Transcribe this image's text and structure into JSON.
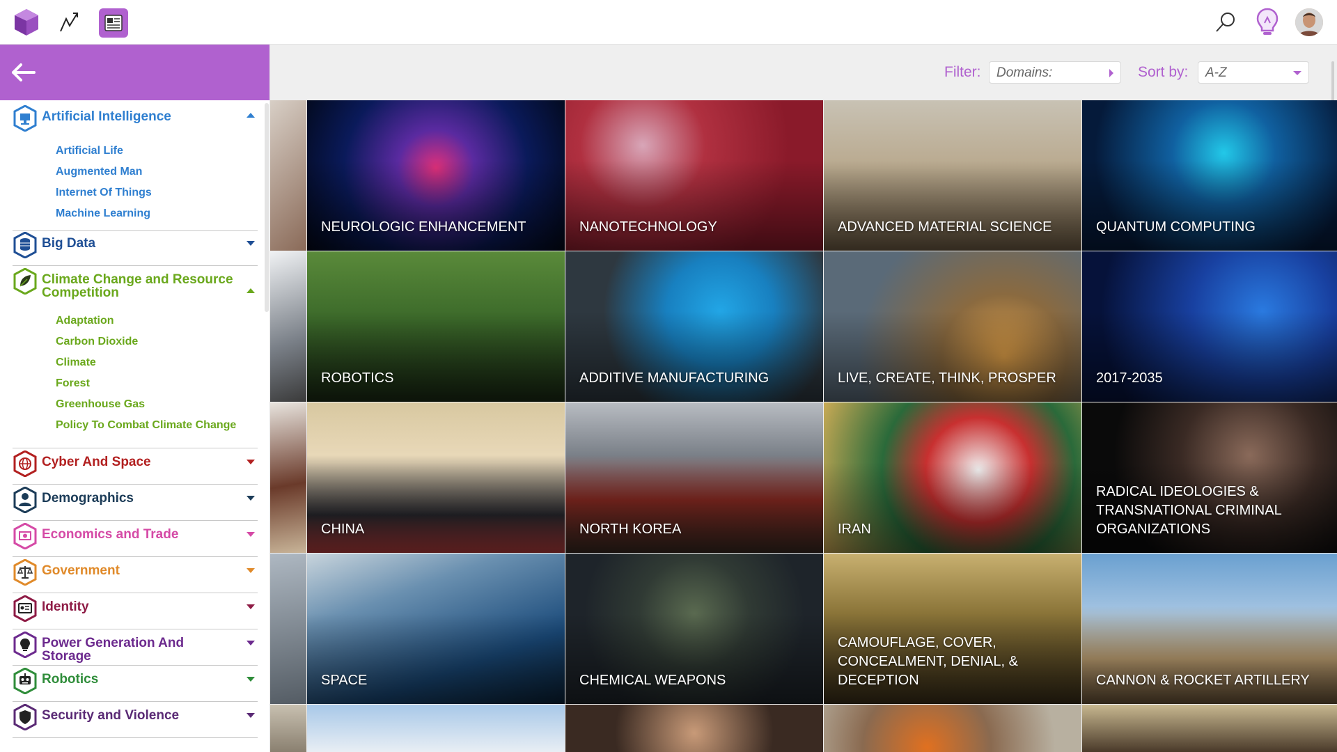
{
  "sidebar": {
    "categories": [
      {
        "title": "Artificial Intelligence",
        "color": "#2f7fd0",
        "expanded": true,
        "icon": "computer-monitor-icon",
        "items": [
          "Artificial Life",
          "Augmented Man",
          "Internet Of Things",
          "Machine Learning"
        ]
      },
      {
        "title": "Big Data",
        "color": "#1f4f95",
        "expanded": false,
        "icon": "database-icon",
        "items": []
      },
      {
        "title": "Climate Change and Resource Competition",
        "color": "#6aa81c",
        "expanded": true,
        "icon": "leaf-icon",
        "items": [
          "Adaptation",
          "Carbon Dioxide",
          "Climate",
          "Forest",
          "Greenhouse Gas",
          "Policy To Combat Climate Change"
        ]
      },
      {
        "title": "Cyber And Space",
        "color": "#b22020",
        "expanded": false,
        "icon": "globe-icon",
        "items": []
      },
      {
        "title": "Demographics",
        "color": "#1c3c58",
        "expanded": false,
        "icon": "person-icon",
        "items": []
      },
      {
        "title": "Economics and Trade",
        "color": "#d54aa6",
        "expanded": false,
        "icon": "money-icon",
        "items": []
      },
      {
        "title": "Government",
        "color": "#e08a2a",
        "expanded": false,
        "icon": "scales-icon",
        "items": []
      },
      {
        "title": "Identity",
        "color": "#8e1b45",
        "expanded": false,
        "icon": "id-card-icon",
        "items": []
      },
      {
        "title": "Power Generation And Storage",
        "color": "#6c2a8e",
        "expanded": false,
        "icon": "power-icon",
        "items": []
      },
      {
        "title": "Robotics",
        "color": "#2f8d3a",
        "expanded": false,
        "icon": "robot-icon",
        "items": []
      },
      {
        "title": "Security and Violence",
        "color": "#5a2a75",
        "expanded": false,
        "icon": "shield-icon",
        "items": []
      }
    ]
  },
  "filter": {
    "filter_label": "Filter:",
    "domains_value": "Domains:",
    "sort_label": "Sort by:",
    "sort_value": "A-Z"
  },
  "tiles": [
    {
      "label": "NEUROLOGIC ENHANCEMENT",
      "bg": "neural",
      "c1": "#0a1a5a",
      "c2": "#e0307a"
    },
    {
      "label": "NANOTECHNOLOGY",
      "bg": "blood",
      "c1": "#8a1a2a",
      "c2": "#d8a6b8"
    },
    {
      "label": "ADVANCED MATERIAL SCIENCE",
      "bg": "desert",
      "c1": "#b9a98e",
      "c2": "#6f5d44"
    },
    {
      "label": "QUANTUM COMPUTING",
      "bg": "chip",
      "c1": "#051a3a",
      "c2": "#22c8e8"
    },
    {
      "label": "ROBOTICS",
      "bg": "forest",
      "c1": "#3c6a2a",
      "c2": "#1a2a14"
    },
    {
      "label": "ADDITIVE MANUFACTURING",
      "bg": "printer",
      "c1": "#2e3840",
      "c2": "#22a6e6"
    },
    {
      "label": "LIVE, CREATE, THINK, PROSPER",
      "bg": "soldier",
      "c1": "#5a6a78",
      "c2": "#e0a048"
    },
    {
      "label": "2017-2035",
      "bg": "code",
      "c1": "#06123a",
      "c2": "#2a7ae0"
    },
    {
      "label": "CHINA",
      "bg": "meeting",
      "c1": "#d8c8a0",
      "c2": "#2a2a30"
    },
    {
      "label": "NORTH KOREA",
      "bg": "korea",
      "c1": "#7a8088",
      "c2": "#8a2a22"
    },
    {
      "label": "IRAN",
      "bg": "flag",
      "c1": "#d8b058",
      "c2": "#2a6a3a"
    },
    {
      "label": "RADICAL IDEOLOGIES & TRANSNATIONAL CRIMINAL ORGANIZATIONS",
      "bg": "tattoo",
      "c1": "#0a0a0a",
      "c2": "#8a6a5a"
    },
    {
      "label": "SPACE",
      "bg": "space",
      "c1": "#1a4a7a",
      "c2": "#c8d4dc"
    },
    {
      "label": "CHEMICAL WEAPONS",
      "bg": "gasmask",
      "c1": "#1e242a",
      "c2": "#5a6a50"
    },
    {
      "label": "CAMOUFLAGE, COVER, CONCEALMENT, DENIAL, & DECEPTION",
      "bg": "grass",
      "c1": "#8a7438",
      "c2": "#3a2e18"
    },
    {
      "label": "CANNON & ROCKET ARTILLERY",
      "bg": "artillery",
      "c1": "#6aa0d0",
      "c2": "#c8a878"
    },
    {
      "label": "",
      "bg": "sky",
      "c1": "#a8c8e8",
      "c2": "#e8eef4"
    },
    {
      "label": "",
      "bg": "face",
      "c1": "#c89a78",
      "c2": "#3a2a22"
    },
    {
      "label": "",
      "bg": "explosion",
      "c1": "#b8b0a0",
      "c2": "#e07020"
    },
    {
      "label": "",
      "bg": "troops",
      "c1": "#c8b890",
      "c2": "#4a3a2a"
    }
  ]
}
